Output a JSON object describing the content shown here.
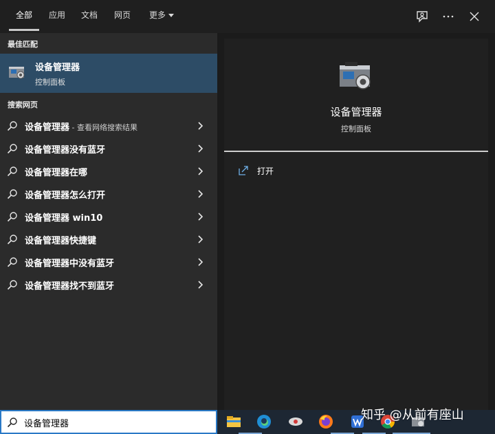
{
  "tabs": [
    {
      "label": "全部",
      "active": true
    },
    {
      "label": "应用"
    },
    {
      "label": "文档"
    },
    {
      "label": "网页"
    },
    {
      "label": "更多"
    }
  ],
  "top_icons": [
    "feedback-icon",
    "more-options-icon",
    "close-icon"
  ],
  "best_match": {
    "header": "最佳匹配",
    "title": "设备管理器",
    "subtitle": "控制面板",
    "icon": "device-manager-icon"
  },
  "web_search": {
    "header": "搜索网页",
    "items": [
      {
        "query": "设备管理器",
        "suffix": " - 查看网络搜索结果"
      },
      {
        "query": "设备管理器没有蓝牙"
      },
      {
        "query": "设备管理器在哪"
      },
      {
        "query": "设备管理器怎么打开"
      },
      {
        "query": "设备管理器 win10"
      },
      {
        "query": "设备管理器快捷键"
      },
      {
        "query": "设备管理器中没有蓝牙"
      },
      {
        "query": "设备管理器找不到蓝牙"
      }
    ]
  },
  "detail": {
    "title": "设备管理器",
    "subtitle": "控制面板",
    "actions": [
      {
        "label": "打开",
        "icon": "open-icon"
      }
    ]
  },
  "search": {
    "value": "设备管理器"
  },
  "taskbar": [
    "file-explorer-icon",
    "edge-icon",
    "app-icon",
    "firefox-icon",
    "wps-icon",
    "chrome-icon",
    "device-manager-icon"
  ],
  "watermark": "知乎 @从前有座山",
  "colors": {
    "highlight": "#2d4c66",
    "search_border": "#2a79c6"
  }
}
